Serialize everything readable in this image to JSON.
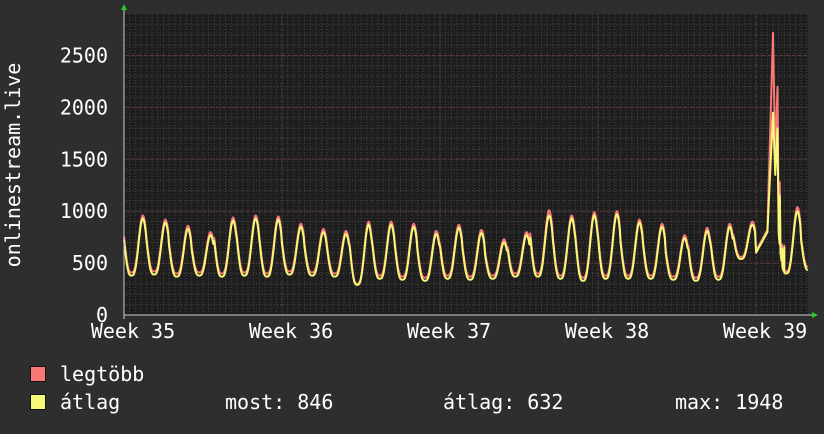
{
  "y_axis_label": "onlinestream.live",
  "legend": [
    {
      "label": "legtöbb",
      "color": "#f87878"
    },
    {
      "label": "átlag",
      "color": "#f8f878"
    }
  ],
  "stats": {
    "now": "most: 846",
    "avg": "átlag: 632",
    "max": "max: 1948"
  },
  "colors": {
    "background": "#2e2e2e",
    "plot_bg": "#1e1e1e",
    "grid_minor": "#474747",
    "grid_major": "#6a3a3a",
    "axis_arrow": "#22cc22"
  },
  "chart_data": {
    "type": "line",
    "xlabel": "",
    "ylabel": "onlinestream.live",
    "ylim": [
      0,
      2900
    ],
    "yticks": [
      0,
      500,
      1000,
      1500,
      2000,
      2500
    ],
    "xticks": [
      {
        "label": "Week 35",
        "day": 0
      },
      {
        "label": "Week 36",
        "day": 7
      },
      {
        "label": "Week 37",
        "day": 14
      },
      {
        "label": "Week 38",
        "day": 21
      },
      {
        "label": "Week 39",
        "day": 28
      }
    ],
    "xlim": [
      0,
      30.3
    ],
    "grid": true,
    "series": [
      {
        "name": "legtöbb",
        "color": "#f87878",
        "daily_peaks": [
          960,
          920,
          860,
          800,
          940,
          960,
          950,
          880,
          830,
          810,
          900,
          900,
          880,
          810,
          870,
          820,
          730,
          800,
          1010,
          960,
          990,
          1000,
          920,
          880,
          770,
          840,
          880,
          900,
          2720,
          1040,
          900
        ],
        "daily_lows": [
          410,
          420,
          400,
          410,
          400,
          410,
          400,
          420,
          410,
          400,
          300,
          380,
          370,
          360,
          380,
          370,
          380,
          400,
          400,
          380,
          360,
          380,
          380,
          380,
          370,
          360,
          370,
          560,
          620,
          420,
          460
        ],
        "samples": [
          {
            "x": 28.75,
            "y": 2720
          },
          {
            "x": 28.85,
            "y": 1500
          },
          {
            "x": 28.95,
            "y": 2200
          },
          {
            "x": 29.05,
            "y": 1280
          },
          {
            "x": 29.15,
            "y": 680
          }
        ]
      },
      {
        "name": "átlag",
        "color": "#f8f878",
        "daily_peaks": [
          930,
          890,
          830,
          770,
          910,
          930,
          920,
          850,
          800,
          780,
          870,
          870,
          850,
          780,
          840,
          790,
          700,
          770,
          960,
          930,
          960,
          970,
          890,
          850,
          740,
          810,
          850,
          870,
          1948,
          1000,
          870
        ],
        "daily_lows": [
          380,
          390,
          370,
          380,
          370,
          380,
          370,
          390,
          380,
          370,
          290,
          350,
          340,
          330,
          350,
          340,
          350,
          370,
          370,
          350,
          330,
          350,
          350,
          350,
          340,
          330,
          340,
          540,
          600,
          400,
          430
        ],
        "samples": [
          {
            "x": 28.75,
            "y": 1948
          },
          {
            "x": 28.85,
            "y": 1350
          },
          {
            "x": 28.95,
            "y": 1800
          },
          {
            "x": 29.05,
            "y": 1150
          },
          {
            "x": 29.15,
            "y": 640
          }
        ]
      }
    ]
  }
}
